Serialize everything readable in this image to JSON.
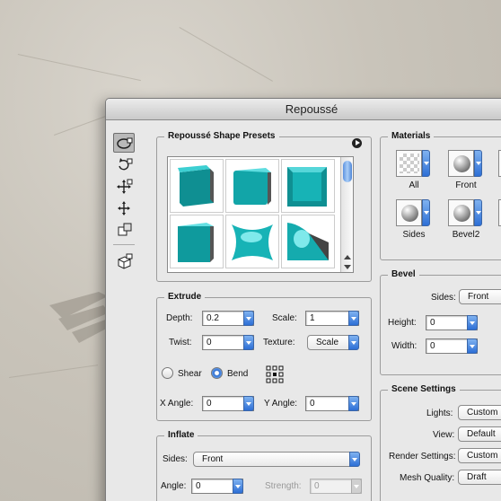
{
  "window": {
    "title": "Repoussé"
  },
  "tools": [
    {
      "icon": "object-rotate-icon",
      "selected": true
    },
    {
      "icon": "object-roll-icon"
    },
    {
      "icon": "object-pan-icon"
    },
    {
      "icon": "object-slide-icon"
    },
    {
      "icon": "object-scale-icon"
    },
    {
      "icon": "camera-view-icon"
    }
  ],
  "presets": {
    "title": "Repoussé Shape Presets"
  },
  "extrude": {
    "title": "Extrude",
    "depth_label": "Depth:",
    "depth": "0.2",
    "scale_label": "Scale:",
    "scale": "1",
    "twist_label": "Twist:",
    "twist": "0",
    "texture_label": "Texture:",
    "texture": "Scale",
    "shear_label": "Shear",
    "bend_label": "Bend",
    "mode": "Bend",
    "xangle_label": "X Angle:",
    "xangle": "0",
    "yangle_label": "Y Angle:",
    "yangle": "0"
  },
  "inflate": {
    "title": "Inflate",
    "sides_label": "Sides:",
    "sides": "Front",
    "angle_label": "Angle:",
    "angle": "0",
    "strength_label": "Strength:",
    "strength": "0"
  },
  "materials": {
    "title": "Materials",
    "items": [
      {
        "label": "All",
        "swatch": "checker"
      },
      {
        "label": "Front",
        "swatch": "sphere"
      },
      {
        "label": "Sides",
        "swatch": "sphere"
      },
      {
        "label": "Bevel2",
        "swatch": "sphere"
      }
    ]
  },
  "bevel": {
    "title": "Bevel",
    "sides_label": "Sides:",
    "sides": "Front",
    "height_label": "Height:",
    "height": "0",
    "width_label": "Width:",
    "width": "0"
  },
  "scene": {
    "title": "Scene Settings",
    "lights_label": "Lights:",
    "lights": "Custom",
    "view_label": "View:",
    "view": "Default",
    "render_label": "Render Settings:",
    "render": "Custom",
    "mesh_label": "Mesh Quality:",
    "mesh": "Draft"
  },
  "colors": {
    "accent": "#2d6fd6",
    "preset_teal": "#12a5a8"
  }
}
